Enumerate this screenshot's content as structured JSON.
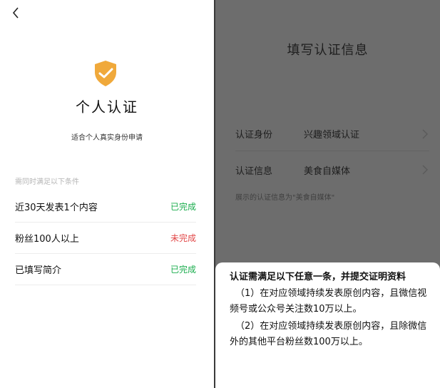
{
  "left": {
    "title": "个人认证",
    "subtitle": "适合个人真实身份申请",
    "section_label": "需同时满足以下条件",
    "conditions": [
      {
        "text": "近30天发表1个内容",
        "status": "已完成",
        "done": true
      },
      {
        "text": "粉丝100人以上",
        "status": "未完成",
        "done": false
      },
      {
        "text": "已填写简介",
        "status": "已完成",
        "done": true
      }
    ],
    "bottom_text": "…",
    "colors": {
      "done": "#1aad4d",
      "undone": "#e24848",
      "shield": "#f0a93b"
    }
  },
  "right": {
    "title": "填写认证信息",
    "rows": [
      {
        "label": "认证身份",
        "value": "兴趣领域认证"
      },
      {
        "label": "认证信息",
        "value": "美食自媒体"
      }
    ],
    "hint": "展示的认证信息为\"美食自媒体\"",
    "sheet": {
      "heading": "认证需满足以下任意一条，并提交证明资料",
      "items": [
        "（1）在对应领域持续发表原创内容，且微信视频号或公众号关注数10万以上。",
        "（2）在对应领域持续发表原创内容，且除微信外的其他平台粉丝数100万以上。"
      ]
    }
  }
}
